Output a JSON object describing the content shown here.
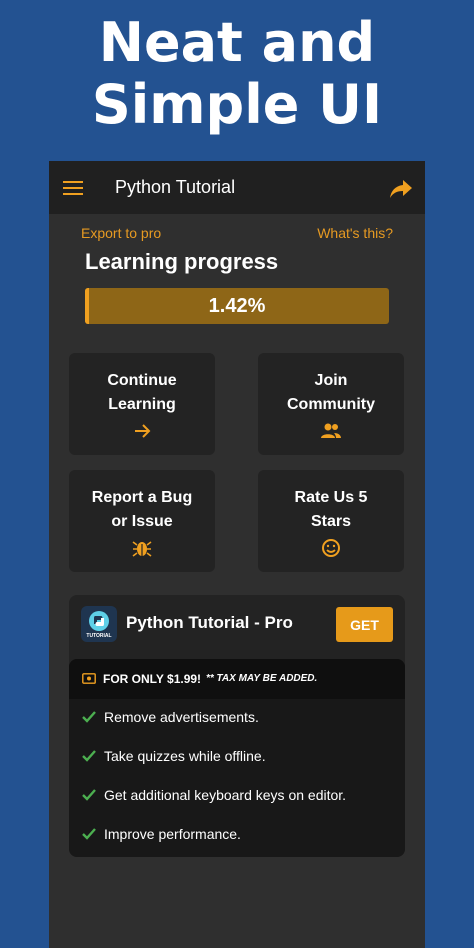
{
  "promo": {
    "line1": "Neat and",
    "line2": "Simple UI"
  },
  "appbar": {
    "title": "Python Tutorial",
    "menu_icon": "hamburger-menu-icon",
    "share_icon": "share-arrow-icon"
  },
  "links": {
    "export": "Export to pro",
    "whats_this": "What's this?"
  },
  "progress": {
    "title": "Learning progress",
    "value_text": "1.42%",
    "value": 1.42
  },
  "cards": [
    {
      "label": "Continue\nLearning",
      "icon": "arrow-right-icon"
    },
    {
      "label": "Join\nCommunity",
      "icon": "people-icon"
    },
    {
      "label": "Report a Bug\nor Issue",
      "icon": "bug-icon"
    },
    {
      "label": "Rate Us 5\nStars",
      "icon": "smiley-icon"
    }
  ],
  "pro": {
    "title": "Python Tutorial - Pro",
    "logo_text": "TUTORIAL",
    "get_label": "GET",
    "price": "FOR ONLY $1.99!",
    "tax_note": "** TAX MAY BE ADDED.",
    "features": [
      "Remove advertisements.",
      "Take quizzes while offline.",
      "Get additional keyboard keys on editor.",
      "Improve performance."
    ]
  },
  "colors": {
    "accent": "#F0A020",
    "background": "#235291",
    "check": "#4CAF50"
  }
}
